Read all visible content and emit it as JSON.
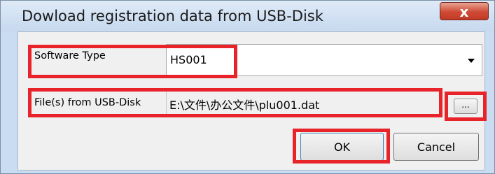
{
  "dialog": {
    "title": "Dowload registration data from USB-Disk",
    "close_label": "x"
  },
  "fields": {
    "software_type_label": "Software Type",
    "software_type_value": "HS001",
    "files_label": "File(s) from USB-Disk",
    "files_value": "E:\\文件\\办公文件\\plu001.dat",
    "browse_label": "..."
  },
  "buttons": {
    "ok_label": "OK",
    "cancel_label": "Cancel"
  },
  "colors": {
    "highlight": "#e8232a",
    "titlebar": "#c6d9ef",
    "client_bg": "#f0f0f0"
  },
  "icons": {
    "close": "close-icon",
    "dropdown": "chevron-down-icon"
  }
}
